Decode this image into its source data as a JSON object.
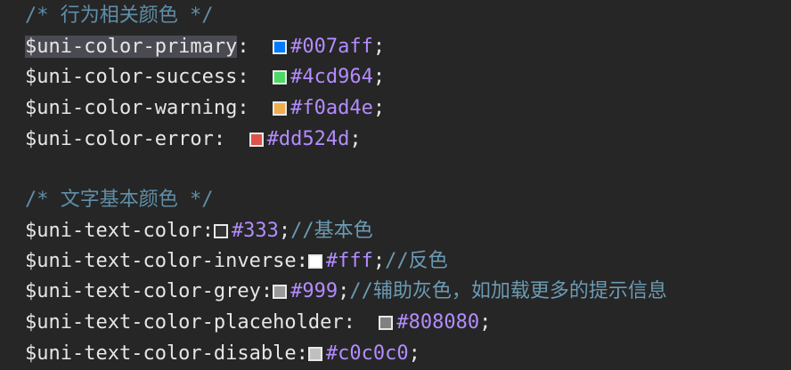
{
  "comments": {
    "behavior": "/* 行为相关颜色 */",
    "text": "/* 文字基本颜色 */"
  },
  "lines": [
    {
      "name": "$uni-color-primary",
      "sep": ":  ",
      "swatch": "#007aff",
      "value": "#007aff",
      "end": ";"
    },
    {
      "name": "$uni-color-success",
      "sep": ":  ",
      "swatch": "#4cd964",
      "value": "#4cd964",
      "end": ";"
    },
    {
      "name": "$uni-color-warning",
      "sep": ":  ",
      "swatch": "#f0ad4e",
      "value": "#f0ad4e",
      "end": ";"
    },
    {
      "name": "$uni-color-error",
      "sep": ":  ",
      "swatch": "#dd524d",
      "value": "#dd524d",
      "end": ";"
    },
    {
      "name": "$uni-text-color",
      "sep": ":",
      "swatch": "#333333",
      "value": "#333",
      "end": ";",
      "comment": "//基本色"
    },
    {
      "name": "$uni-text-color-inverse",
      "sep": ":",
      "swatch": "#ffffff",
      "value": "#fff",
      "end": ";",
      "comment": "//反色"
    },
    {
      "name": "$uni-text-color-grey",
      "sep": ":",
      "swatch": "#999999",
      "value": "#999",
      "end": ";",
      "comment": "//辅助灰色，如加载更多的提示信息"
    },
    {
      "name": "$uni-text-color-placeholder",
      "sep": ":  ",
      "swatch": "#808080",
      "value": "#808080",
      "end": ";"
    },
    {
      "name": "$uni-text-color-disable",
      "sep": ":",
      "swatch": "#c0c0c0",
      "value": "#c0c0c0",
      "end": ";"
    }
  ]
}
